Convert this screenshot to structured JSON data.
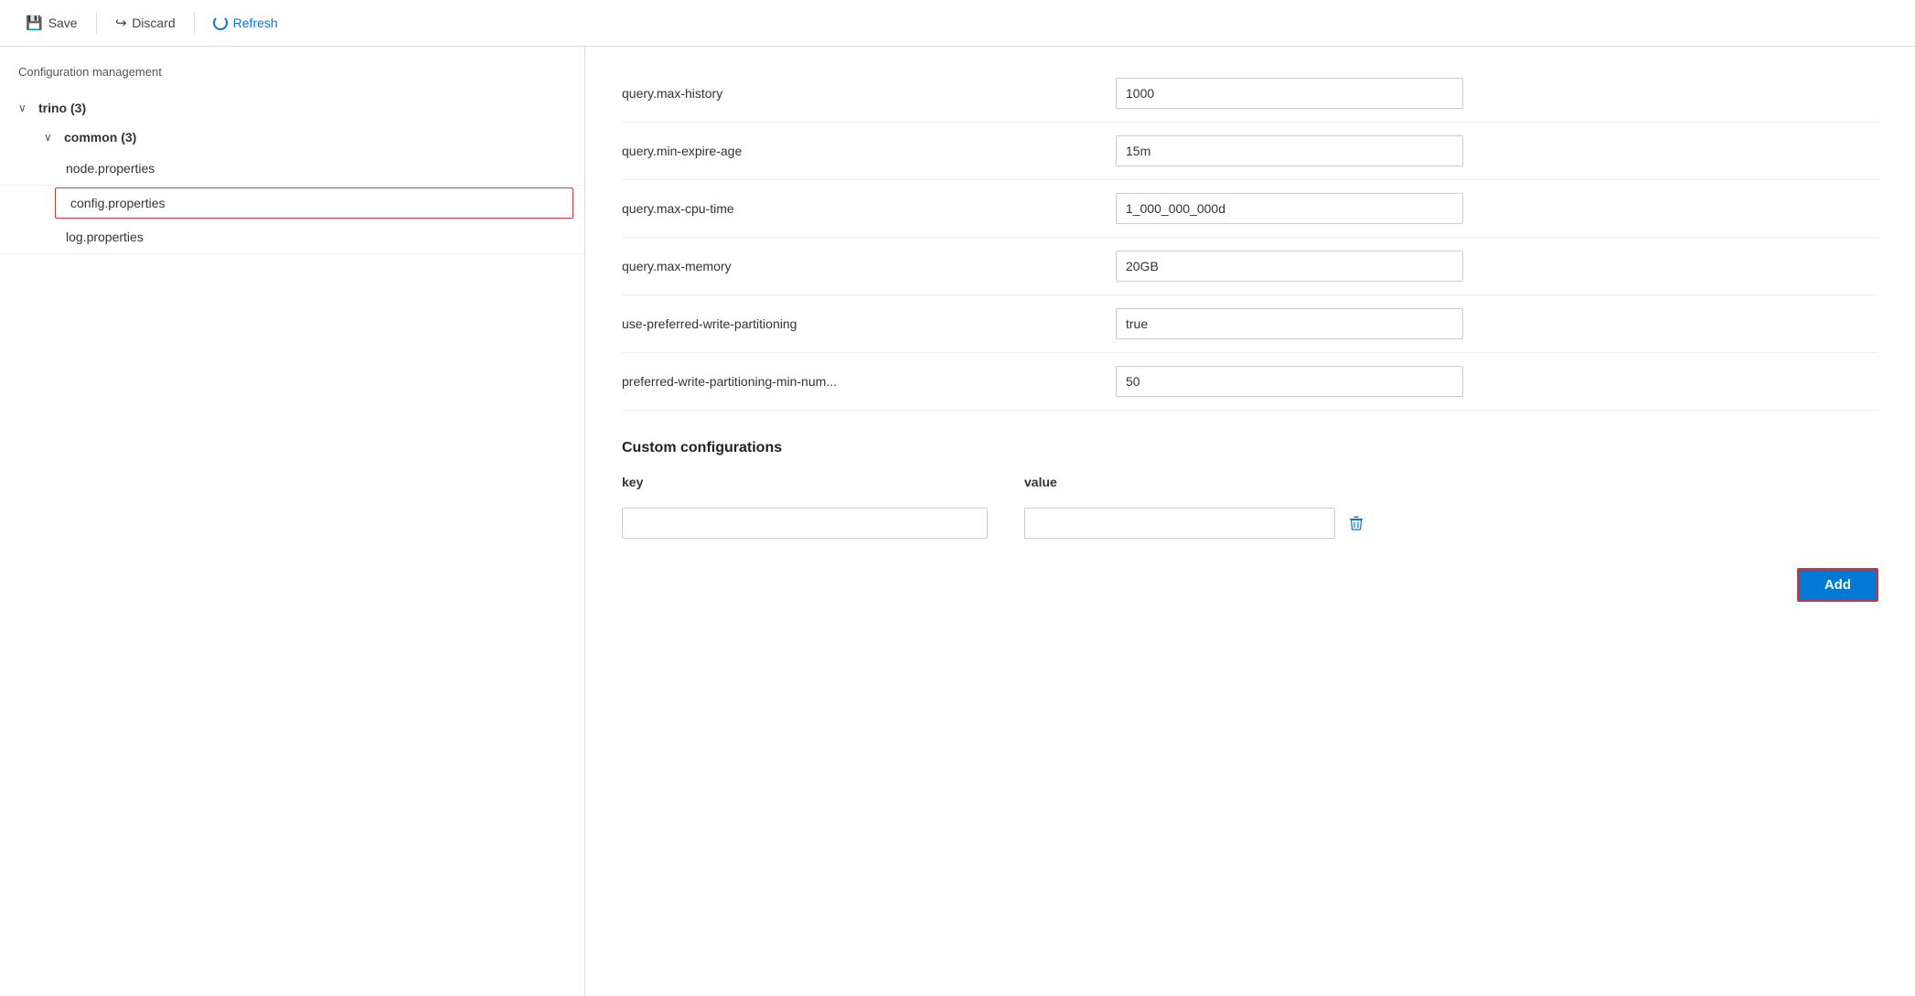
{
  "toolbar": {
    "save_label": "Save",
    "discard_label": "Discard",
    "refresh_label": "Refresh"
  },
  "sidebar": {
    "title": "Configuration management",
    "tree": {
      "root_label": "trino (3)",
      "root_count": 3,
      "sub_label": "common (3)",
      "sub_count": 3,
      "leaves": [
        {
          "id": "node-properties",
          "label": "node.properties",
          "selected": false
        },
        {
          "id": "config-properties",
          "label": "config.properties",
          "selected": true
        },
        {
          "id": "log-properties",
          "label": "log.properties",
          "selected": false
        }
      ]
    }
  },
  "configs": [
    {
      "id": "query-max-history",
      "label": "query.max-history",
      "value": "1000"
    },
    {
      "id": "query-min-expire-age",
      "label": "query.min-expire-age",
      "value": "15m"
    },
    {
      "id": "query-max-cpu-time",
      "label": "query.max-cpu-time",
      "value": "1_000_000_000d"
    },
    {
      "id": "query-max-memory",
      "label": "query.max-memory",
      "value": "20GB"
    },
    {
      "id": "use-preferred-write-partitioning",
      "label": "use-preferred-write-partitioning",
      "value": "true"
    },
    {
      "id": "preferred-write-partitioning-min-num",
      "label": "preferred-write-partitioning-min-num...",
      "value": "50"
    }
  ],
  "custom_configurations": {
    "section_label": "Custom configurations",
    "key_col_label": "key",
    "value_col_label": "value",
    "rows": [
      {
        "key": "",
        "value": ""
      }
    ],
    "add_button_label": "Add"
  }
}
